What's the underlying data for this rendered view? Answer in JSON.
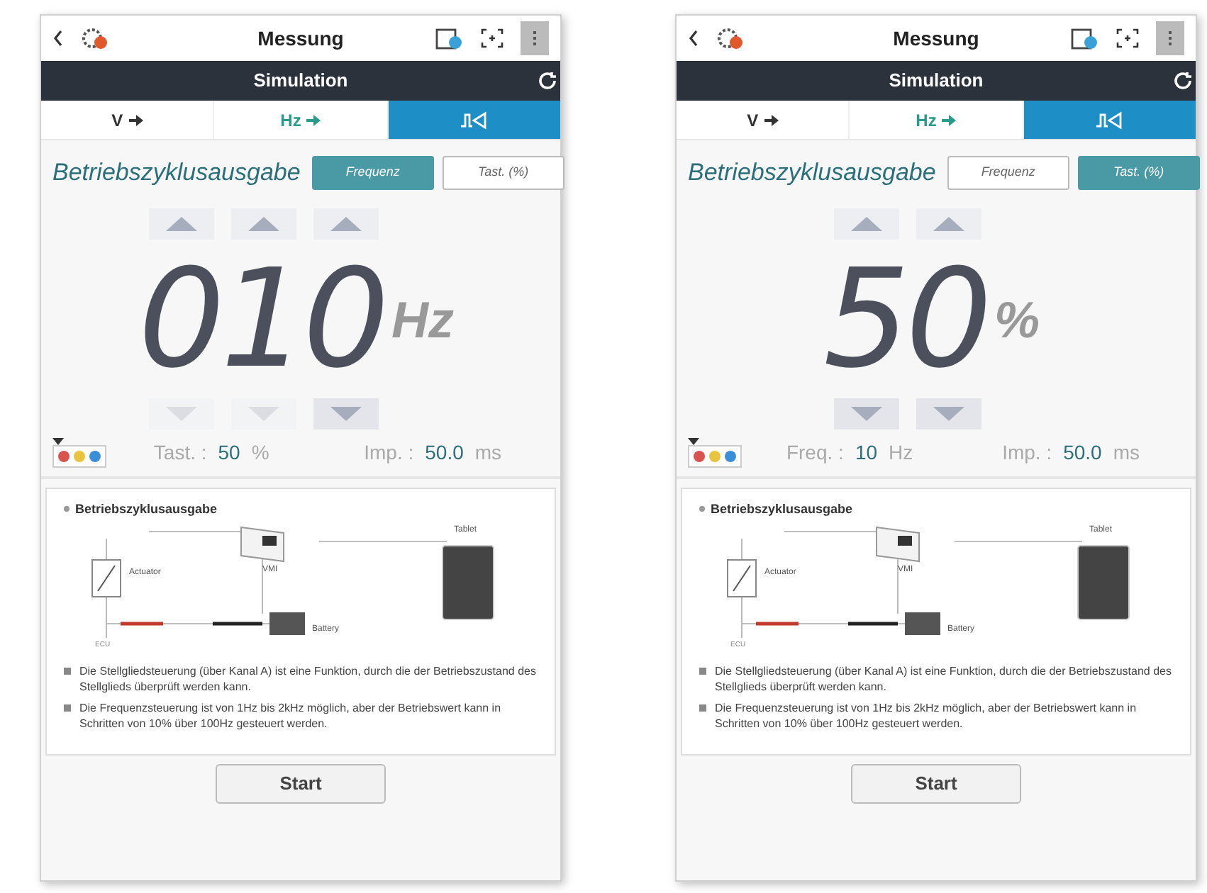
{
  "screens": [
    {
      "header": {
        "title": "Messung"
      },
      "section_bar": {
        "title": "Simulation"
      },
      "tabs": [
        {
          "label": "V",
          "kind": "text",
          "selected": false
        },
        {
          "label": "Hz",
          "kind": "text",
          "selected": false
        },
        {
          "kind": "icon",
          "selected": true
        }
      ],
      "heading": "Betriebszyklusausgabe",
      "modes": [
        {
          "label": "Frequenz",
          "selected": true
        },
        {
          "label": "Tast. (%)",
          "selected": false
        }
      ],
      "digits": [
        {
          "value": "0",
          "up_disabled": false,
          "down_disabled": true
        },
        {
          "value": "1",
          "up_disabled": false,
          "down_disabled": true
        },
        {
          "value": "0",
          "up_disabled": false,
          "down_disabled": false
        }
      ],
      "unit": "Hz",
      "readings": [
        {
          "label": "Tast. :",
          "value": "50",
          "unit": "%"
        },
        {
          "label": "Imp. :",
          "value": "50.0",
          "unit": "ms"
        }
      ],
      "info": {
        "title": "Betriebszyklusausgabe",
        "labels": {
          "tablet": "Tablet",
          "actuator": "Actuator",
          "vmi": "VMI",
          "battery": "Battery",
          "ecu": "ECU"
        },
        "bullets": [
          "Die Stellgliedsteuerung (über Kanal A) ist eine Funktion, durch die der Betriebszustand des Stellglieds überprüft werden kann.",
          "Die Frequenzsteuerung ist von 1Hz bis 2kHz möglich, aber der Betriebswert kann in Schritten von 10% über 100Hz gesteuert werden."
        ]
      },
      "start": "Start"
    },
    {
      "header": {
        "title": "Messung"
      },
      "section_bar": {
        "title": "Simulation"
      },
      "tabs": [
        {
          "label": "V",
          "kind": "text",
          "selected": false
        },
        {
          "label": "Hz",
          "kind": "text",
          "selected": false
        },
        {
          "kind": "icon",
          "selected": true
        }
      ],
      "heading": "Betriebszyklusausgabe",
      "modes": [
        {
          "label": "Frequenz",
          "selected": false
        },
        {
          "label": "Tast. (%)",
          "selected": true
        }
      ],
      "digits": [
        {
          "value": "5",
          "up_disabled": false,
          "down_disabled": false
        },
        {
          "value": "0",
          "up_disabled": false,
          "down_disabled": false
        }
      ],
      "unit": "%",
      "readings": [
        {
          "label": "Freq. :",
          "value": "10",
          "unit": "Hz"
        },
        {
          "label": "Imp. :",
          "value": "50.0",
          "unit": "ms"
        }
      ],
      "info": {
        "title": "Betriebszyklusausgabe",
        "labels": {
          "tablet": "Tablet",
          "actuator": "Actuator",
          "vmi": "VMI",
          "battery": "Battery",
          "ecu": "ECU"
        },
        "bullets": [
          "Die Stellgliedsteuerung (über Kanal A) ist eine Funktion, durch die der Betriebszustand des Stellglieds überprüft werden kann.",
          "Die Frequenzsteuerung ist von 1Hz bis 2kHz möglich, aber der Betriebswert kann in Schritten von 10% über 100Hz gesteuert werden."
        ]
      },
      "start": "Start"
    }
  ]
}
